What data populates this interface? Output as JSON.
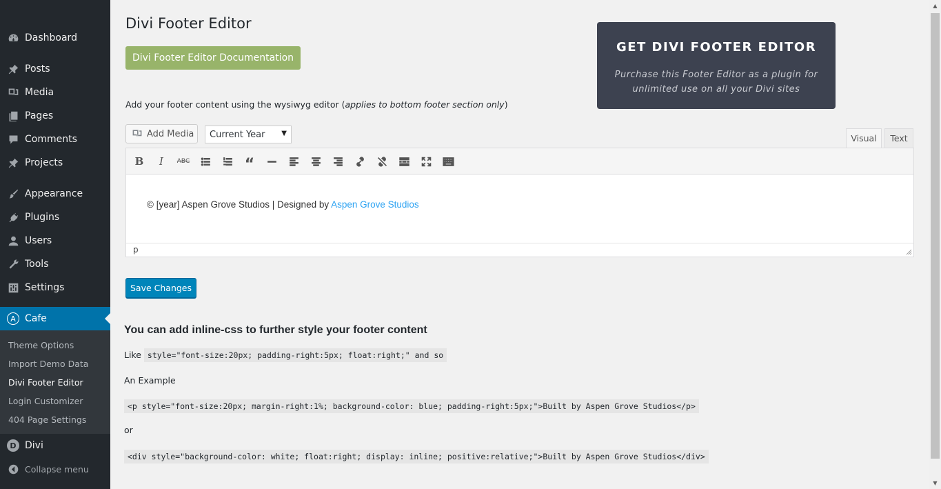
{
  "sidebar": {
    "items": [
      {
        "label": "Dashboard",
        "icon": "dashboard-icon"
      },
      {
        "label": "Posts",
        "icon": "pin-icon"
      },
      {
        "label": "Media",
        "icon": "media-icon"
      },
      {
        "label": "Pages",
        "icon": "pages-icon"
      },
      {
        "label": "Comments",
        "icon": "comment-icon"
      },
      {
        "label": "Projects",
        "icon": "pin-icon"
      },
      {
        "label": "Appearance",
        "icon": "brush-icon"
      },
      {
        "label": "Plugins",
        "icon": "plugin-icon"
      },
      {
        "label": "Users",
        "icon": "user-icon"
      },
      {
        "label": "Tools",
        "icon": "wrench-icon"
      },
      {
        "label": "Settings",
        "icon": "settings-icon"
      },
      {
        "label": "Cafe",
        "icon": "cafe-logo-icon",
        "icon_letter": "A"
      },
      {
        "label": "Divi",
        "icon": "divi-logo-icon",
        "icon_letter": "D"
      }
    ],
    "submenu": [
      {
        "label": "Theme Options"
      },
      {
        "label": "Import Demo Data"
      },
      {
        "label": "Divi Footer Editor"
      },
      {
        "label": "Login Customizer"
      },
      {
        "label": "404 Page Settings"
      }
    ],
    "collapse_label": "Collapse menu"
  },
  "main": {
    "title": "Divi Footer Editor",
    "doc_button": "Divi Footer Editor Documentation",
    "promo": {
      "title": "GET DIVI FOOTER EDITOR",
      "text": "Purchase this Footer Editor as a plugin for unlimited use on all your Divi sites"
    },
    "intro_text": "Add your footer content using the wysiwyg editor (",
    "intro_em": "applies to bottom footer section only",
    "intro_close": ")",
    "add_media": "Add Media",
    "year_select": "Current Year",
    "tabs": {
      "visual": "Visual",
      "text": "Text"
    },
    "editor": {
      "content_text": "© [year] Aspen Grove Studios | Designed by ",
      "content_link": "Aspen Grove Studios",
      "status_path": "p"
    },
    "save_button": "Save Changes",
    "heading": "You can add inline-css to further style your footer content",
    "like_label": "Like",
    "like_code": "style=\"font-size:20px; padding-right:5px; float:right;\" and so",
    "example_label": "An Example",
    "example_code": "<p style=\"font-size:20px; margin-right:1%; background-color: blue; padding-right:5px;\">Built by Aspen Grove Studios</p>",
    "or_label": "or",
    "or_code": "<div style=\"background-color: white; float:right; display: inline; positive:relative;\">Built by Aspen Grove Studios</div>"
  },
  "colors": {
    "sidebar_bg": "#23282d",
    "active_menu": "#0073aa",
    "doc_button": "#98b46a",
    "promo_bg": "#3d4250",
    "save_button": "#0085ba",
    "link": "#2ea3f2"
  }
}
